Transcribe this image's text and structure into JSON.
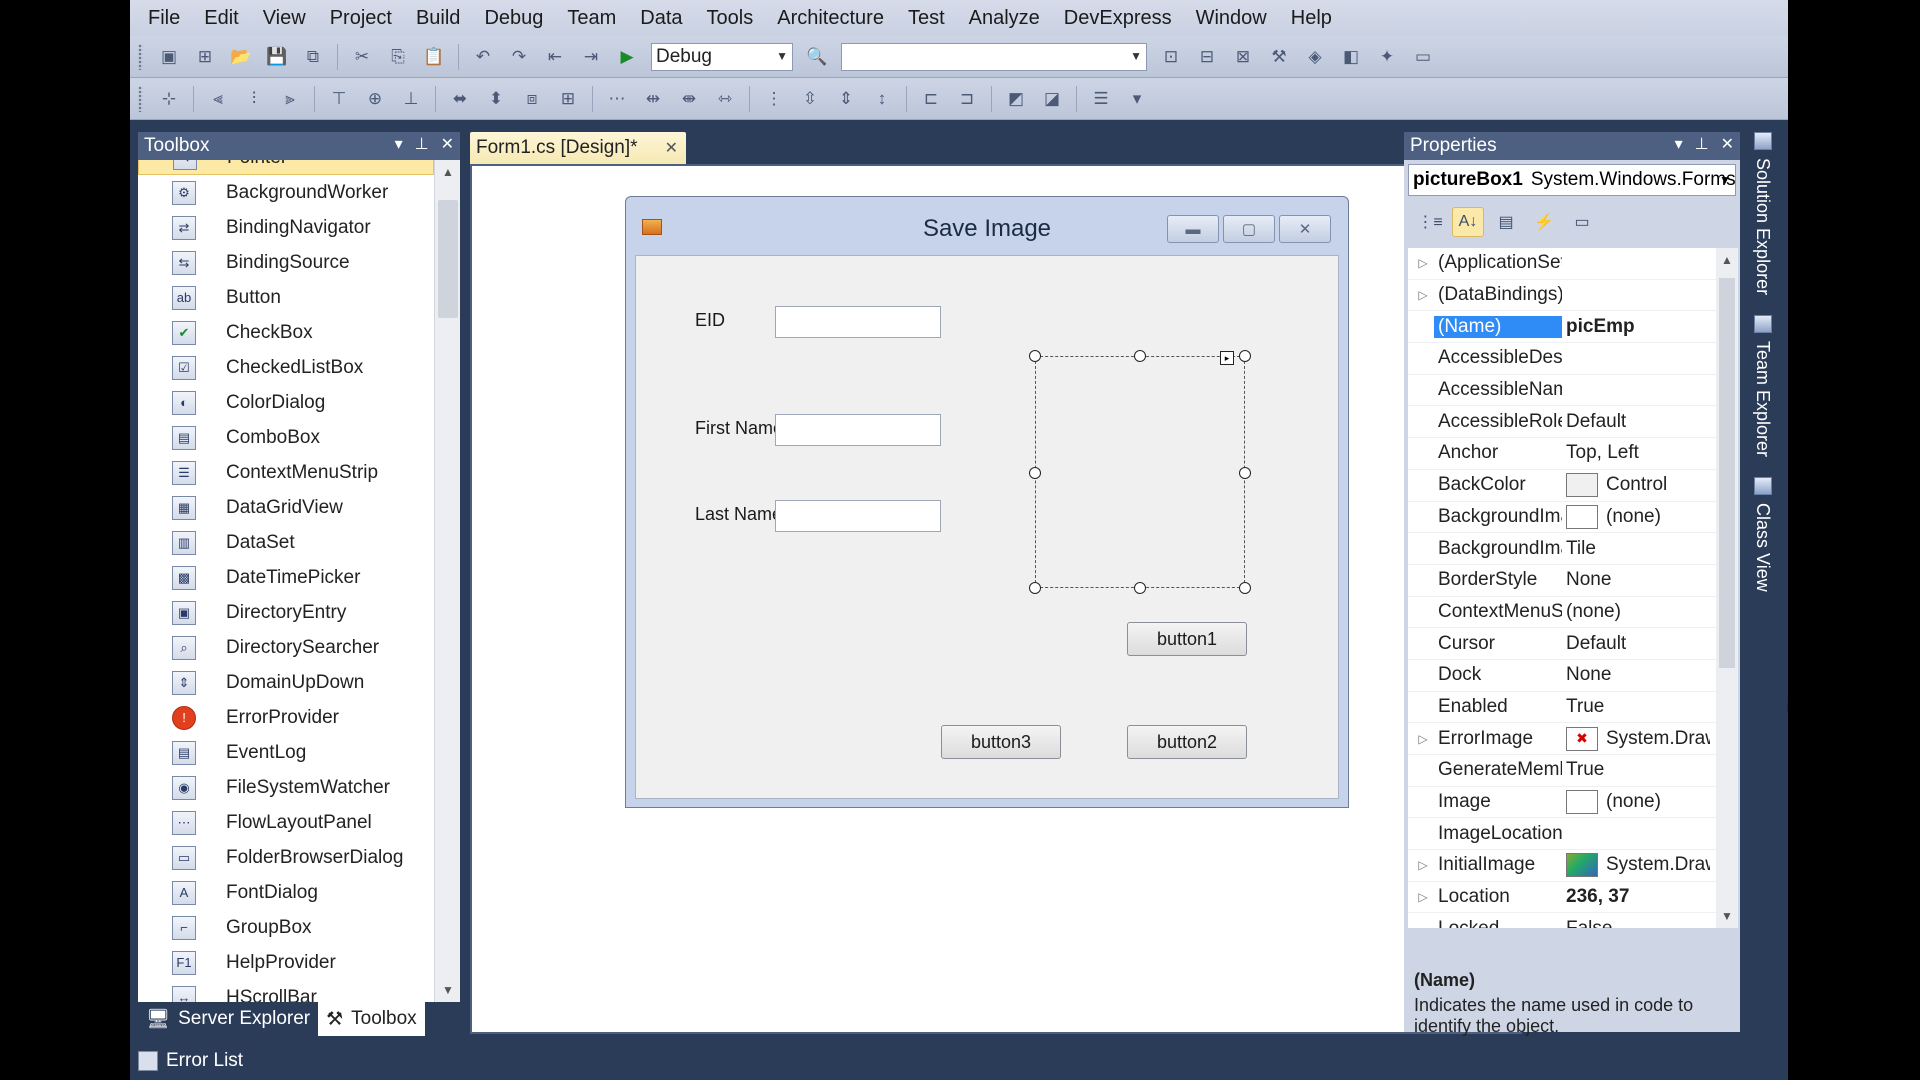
{
  "menu": [
    "File",
    "Edit",
    "View",
    "Project",
    "Build",
    "Debug",
    "Team",
    "Data",
    "Tools",
    "Architecture",
    "Test",
    "Analyze",
    "DevExpress",
    "Window",
    "Help"
  ],
  "toolbar": {
    "config_value": "Debug",
    "find_value": ""
  },
  "toolbox": {
    "title": "Toolbox",
    "items": [
      "Pointer",
      "BackgroundWorker",
      "BindingNavigator",
      "BindingSource",
      "Button",
      "CheckBox",
      "CheckedListBox",
      "ColorDialog",
      "ComboBox",
      "ContextMenuStrip",
      "DataGridView",
      "DataSet",
      "DateTimePicker",
      "DirectoryEntry",
      "DirectorySearcher",
      "DomainUpDown",
      "ErrorProvider",
      "EventLog",
      "FileSystemWatcher",
      "FlowLayoutPanel",
      "FolderBrowserDialog",
      "FontDialog",
      "GroupBox",
      "HelpProvider",
      "HScrollBar"
    ]
  },
  "bottom_tabs": {
    "server_explorer": "Server Explorer",
    "toolbox": "Toolbox",
    "error_list": "Error List"
  },
  "document": {
    "tab": "Form1.cs [Design]*"
  },
  "form": {
    "title": "Save Image",
    "labels": {
      "eid": "EID",
      "first_name": "First Name",
      "last_name": "Last Name"
    },
    "buttons": {
      "button1": "button1",
      "button2": "button2",
      "button3": "button3"
    }
  },
  "properties": {
    "title": "Properties",
    "object_name": "pictureBox1",
    "object_type": "System.Windows.Forms.PictureBox",
    "rows": [
      {
        "name": "(ApplicationSettings)",
        "value": "",
        "expand": true
      },
      {
        "name": "(DataBindings)",
        "value": "",
        "expand": true
      },
      {
        "name": "(Name)",
        "value": "picEmp",
        "selected": true
      },
      {
        "name": "AccessibleDescription",
        "value": ""
      },
      {
        "name": "AccessibleName",
        "value": ""
      },
      {
        "name": "AccessibleRole",
        "value": "Default"
      },
      {
        "name": "Anchor",
        "value": "Top, Left"
      },
      {
        "name": "BackColor",
        "value": "Control",
        "swatch": "color"
      },
      {
        "name": "BackgroundImage",
        "value": "(none)",
        "swatch": "blank"
      },
      {
        "name": "BackgroundImageLayout",
        "value": "Tile"
      },
      {
        "name": "BorderStyle",
        "value": "None"
      },
      {
        "name": "ContextMenuStrip",
        "value": "(none)"
      },
      {
        "name": "Cursor",
        "value": "Default"
      },
      {
        "name": "Dock",
        "value": "None"
      },
      {
        "name": "Enabled",
        "value": "True"
      },
      {
        "name": "ErrorImage",
        "value": "System.Drawing.Bitmap",
        "swatch": "err",
        "expand": true
      },
      {
        "name": "GenerateMember",
        "value": "True"
      },
      {
        "name": "Image",
        "value": "(none)",
        "swatch": "blank"
      },
      {
        "name": "ImageLocation",
        "value": ""
      },
      {
        "name": "InitialImage",
        "value": "System.Drawing.Bitmap",
        "swatch": "pic",
        "expand": true
      },
      {
        "name": "Location",
        "value": "236, 37",
        "expand": true,
        "bold": true
      },
      {
        "name": "Locked",
        "value": "False"
      }
    ],
    "desc_title": "(Name)",
    "desc_text": "Indicates the name used in code to identify the object."
  },
  "right_tabs": [
    "Solution Explorer",
    "Team Explorer",
    "Class View"
  ]
}
